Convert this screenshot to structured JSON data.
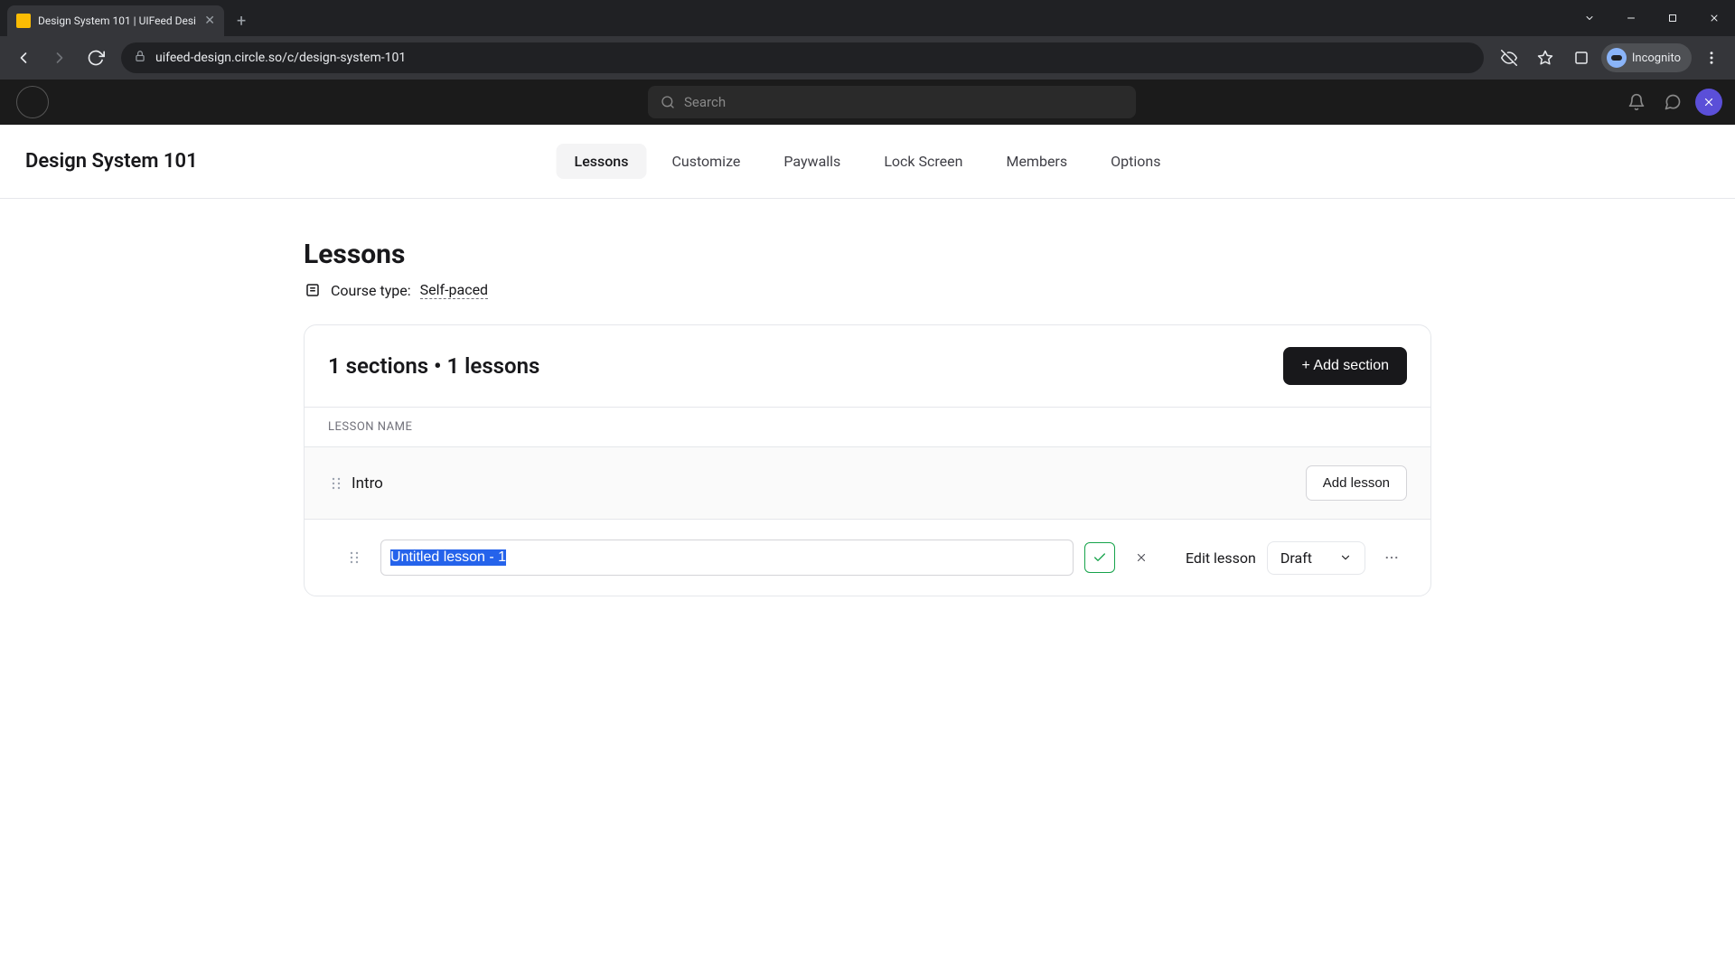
{
  "browser": {
    "tab_title": "Design System 101 | UIFeed Desi",
    "url": "uifeed-design.circle.so/c/design-system-101",
    "incognito_label": "Incognito"
  },
  "app_bg": {
    "search_placeholder": "Search"
  },
  "modal": {
    "course_title": "Design System 101",
    "tabs": [
      "Lessons",
      "Customize",
      "Paywalls",
      "Lock Screen",
      "Members",
      "Options"
    ],
    "active_tab": "Lessons"
  },
  "page": {
    "heading": "Lessons",
    "course_type_label": "Course type:",
    "course_type_value": "Self-paced",
    "summary": "1 sections • 1 lessons",
    "add_section_label": "+ Add section",
    "column_header": "LESSON NAME",
    "section": {
      "name": "Intro",
      "add_lesson_label": "Add lesson"
    },
    "lesson": {
      "name_value": "Untitled lesson - 1",
      "edit_label": "Edit lesson",
      "status": "Draft"
    }
  }
}
